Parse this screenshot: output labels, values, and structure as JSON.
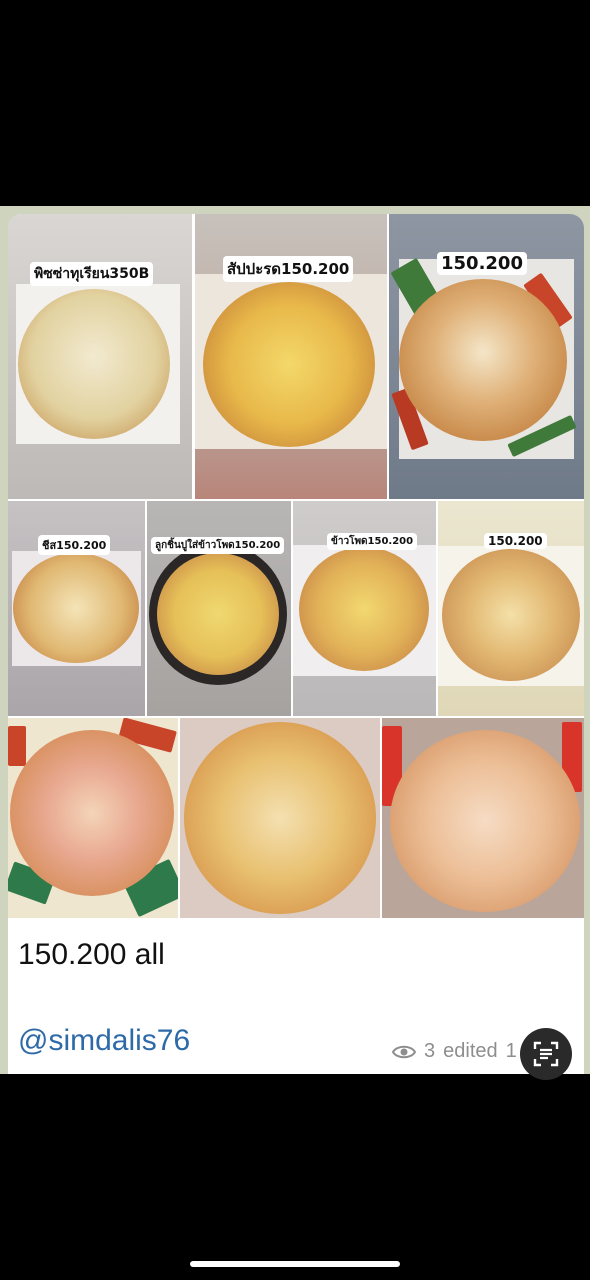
{
  "post": {
    "captions": {
      "durian": "พิซซ่าทุเรียน350B",
      "pineapple": "สัปปะรด150.200",
      "sausage": "150.200",
      "cheese": "ชีส150.200",
      "meatball_corn": "ลูกชิ้นปูใส่ข้าวโพด150.200",
      "corn": "ข้าวโพด150.200",
      "veggie": "150.200"
    },
    "message": "150.200 all",
    "author_handle": "@simdalis76",
    "meta": {
      "views": "3",
      "edited": "edited",
      "time_partial": "1"
    }
  },
  "icons": {
    "views": "eye-icon",
    "scan": "text-scan-icon"
  },
  "colors": {
    "chat_background": "#cfd4bf",
    "bubble": "#ffffff",
    "link": "#2e6aa8",
    "meta_text": "#8e8e8e"
  }
}
